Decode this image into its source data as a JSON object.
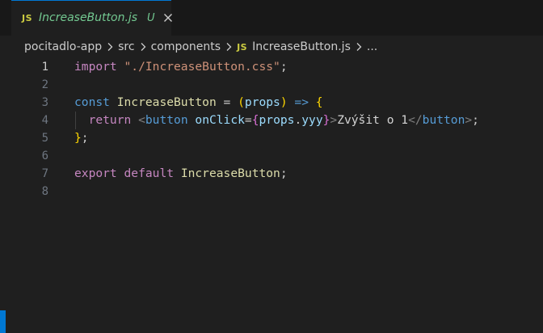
{
  "tab": {
    "icon": "JS",
    "title": "IncreaseButton.js",
    "status": "U",
    "close_icon": "close-icon"
  },
  "breadcrumb": {
    "items": [
      "pocitadlo-app",
      "src",
      "components"
    ],
    "file_icon": "JS",
    "file": "IncreaseButton.js",
    "more": "..."
  },
  "code": {
    "line_numbers": [
      "1",
      "2",
      "3",
      "4",
      "5",
      "6",
      "7",
      "8"
    ],
    "l1": {
      "kw": "import",
      "sp": " ",
      "str": "\"./IncreaseButton.css\"",
      "semi": ";"
    },
    "l3": {
      "kw": "const",
      "sp1": " ",
      "name": "IncreaseButton",
      "eq": " = ",
      "lp": "(",
      "param": "props",
      "rp": ")",
      "arrow": " => ",
      "lb": "{"
    },
    "l4": {
      "indent": "  ",
      "kw": "return",
      "sp": " ",
      "lt": "<",
      "tag": "button",
      "sp2": " ",
      "attr": "onClick",
      "eq": "=",
      "lb": "{",
      "obj": "props",
      "dot": ".",
      "prop": "yyy",
      "rb": "}",
      "gt": ">",
      "text": "Zvýšit o 1",
      "close_lt": "</",
      "close_tag": "button",
      "close_gt": ">",
      "semi": ";"
    },
    "l5": {
      "rb": "}",
      "semi": ";"
    },
    "l7": {
      "kw1": "export",
      "sp1": " ",
      "kw2": "default",
      "sp2": " ",
      "name": "IncreaseButton",
      "semi": ";"
    }
  },
  "colors": {
    "background": "#1f1f1f",
    "tab_accent": "#0078d4",
    "untracked": "#73c991",
    "js_icon": "#cbcb41"
  }
}
